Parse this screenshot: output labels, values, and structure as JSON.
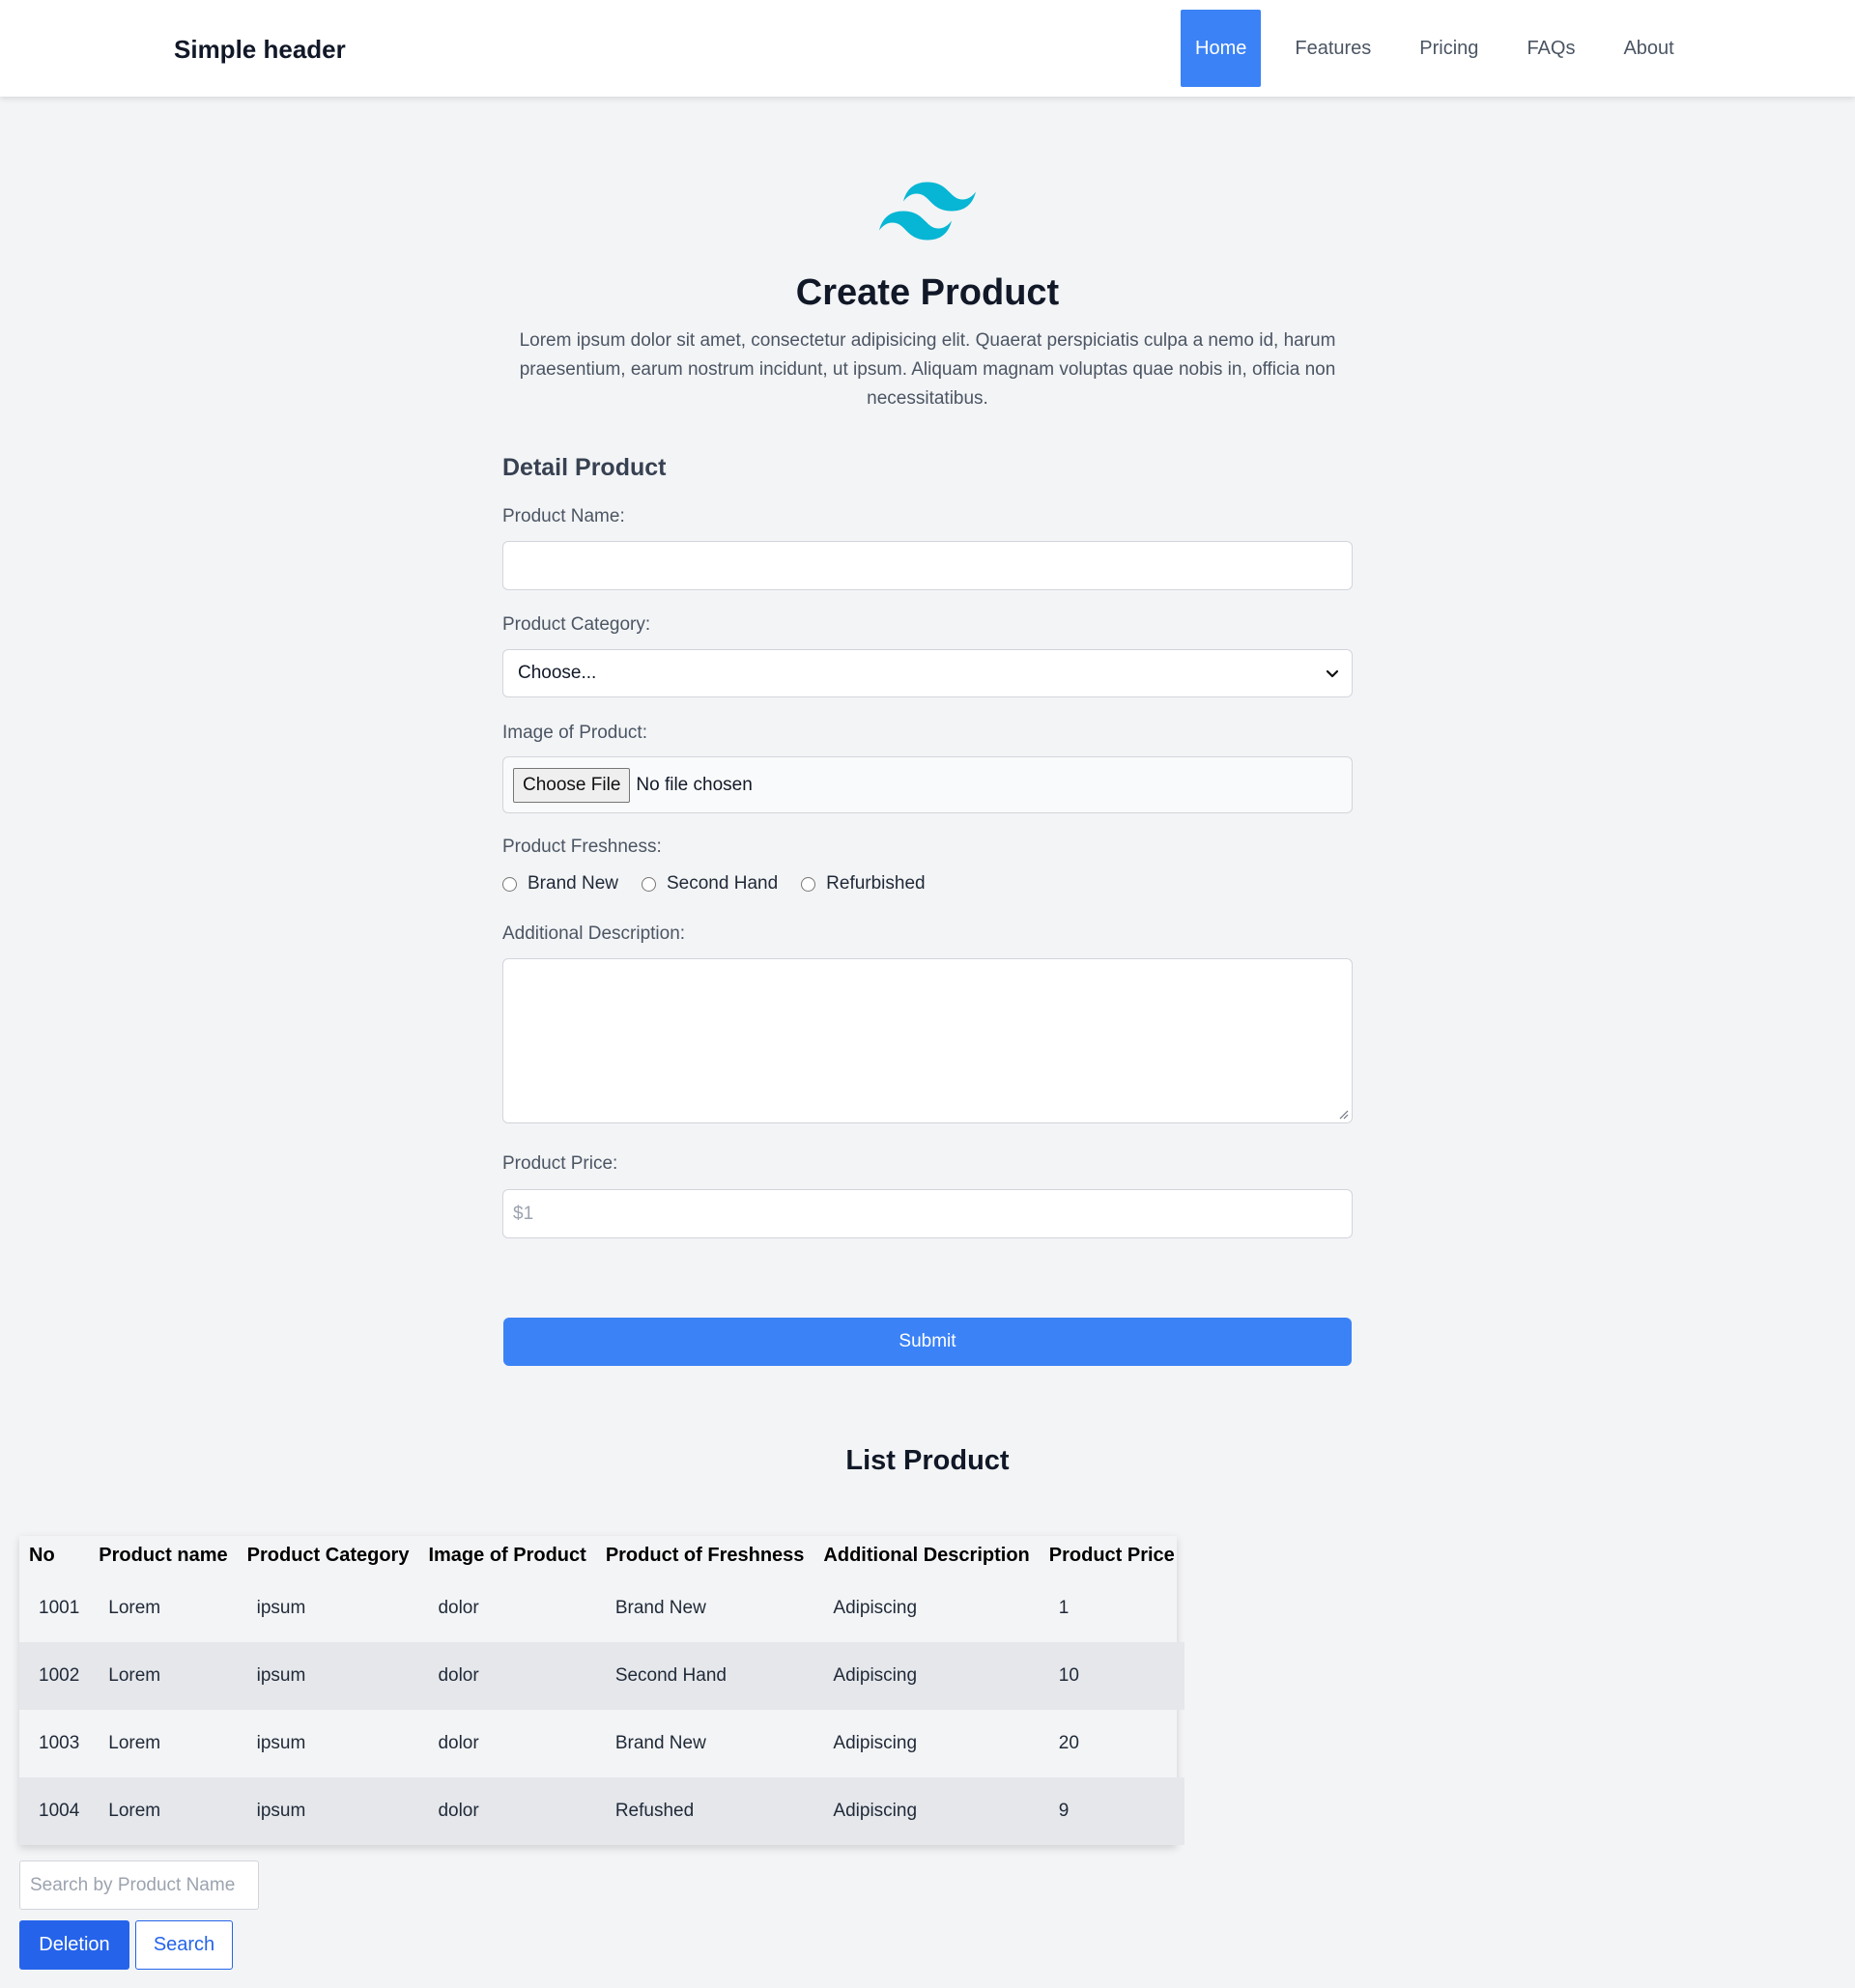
{
  "header": {
    "brand": "Simple header",
    "nav": [
      "Home",
      "Features",
      "Pricing",
      "FAQs",
      "About"
    ],
    "active_nav": "Home"
  },
  "hero": {
    "logo_icon": "tailwind-wave-logo",
    "title": "Create Product",
    "lead": "Lorem ipsum dolor sit amet, consectetur adipisicing elit. Quaerat perspiciatis culpa a nemo id, harum praesentium, earum nostrum incidunt, ut ipsum. Aliquam magnam voluptas quae nobis in, officia non necessitatibus."
  },
  "form": {
    "section_title": "Detail Product",
    "product_name_label": "Product Name:",
    "product_name_value": "",
    "category_label": "Product Category:",
    "category_selected": "Choose...",
    "image_label": "Image of Product:",
    "file_button": "Choose File",
    "file_status": "No file chosen",
    "freshness_label": "Product Freshness:",
    "freshness_options": [
      "Brand New",
      "Second Hand",
      "Refurbished"
    ],
    "description_label": "Additional Description:",
    "description_value": "",
    "price_label": "Product Price:",
    "price_placeholder": "$1",
    "submit_label": "Submit"
  },
  "list": {
    "title": "List Product",
    "columns": [
      "No",
      "Product name",
      "Product Category",
      "Image of Product",
      "Product of Freshness",
      "Additional Description",
      "Product Price"
    ],
    "rows": [
      [
        "1001",
        "Lorem",
        "ipsum",
        "dolor",
        "Brand New",
        "Adipiscing",
        "1"
      ],
      [
        "1002",
        "Lorem",
        "ipsum",
        "dolor",
        "Second Hand",
        "Adipiscing",
        "10"
      ],
      [
        "1003",
        "Lorem",
        "ipsum",
        "dolor",
        "Brand New",
        "Adipiscing",
        "20"
      ],
      [
        "1004",
        "Lorem",
        "ipsum",
        "dolor",
        "Refushed",
        "Adipiscing",
        "9"
      ]
    ],
    "search_placeholder": "Search by Product Name",
    "delete_label": "Deletion",
    "search_label": "Search"
  },
  "colors": {
    "accent": "#3b82f6",
    "button_primary": "#2563eb",
    "logo": "#06b6d4",
    "background": "#f3f4f6"
  }
}
